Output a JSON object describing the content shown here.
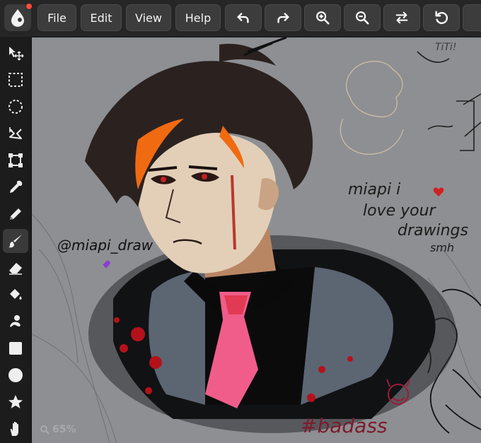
{
  "menu": {
    "file": "File",
    "edit": "Edit",
    "view": "View",
    "help": "Help"
  },
  "toolbar_icons": [
    "undo-icon",
    "redo-icon",
    "zoom-in-icon",
    "zoom-out-icon",
    "swap-icon",
    "rotate-icon"
  ],
  "sidebar_tools": [
    "move-icon",
    "rect-select-icon",
    "ellipse-select-icon",
    "lasso-icon",
    "transform-icon",
    "eyedropper-icon",
    "pencil-icon",
    "brush-icon",
    "eraser-icon",
    "fill-bucket-icon",
    "smudge-icon",
    "square-shape-icon",
    "circle-shape-icon",
    "star-shape-icon",
    "hand-icon"
  ],
  "active_tool": "brush-icon",
  "canvas": {
    "background": "#8d8f92",
    "signature": "@miapi_draw",
    "note_line1": "miapi i",
    "note_line2": "love your",
    "note_line3": "drawings",
    "note_line4": "smh",
    "tag": "#badass",
    "corner_text": "TiTi!"
  },
  "zoom_label": "65%",
  "colors": {
    "accent_dot": "#ff4a3d",
    "tie": "#f05d8a",
    "shirt": "#5c6572",
    "blood": "#b3121b",
    "hair_highlight": "#f06a12"
  }
}
